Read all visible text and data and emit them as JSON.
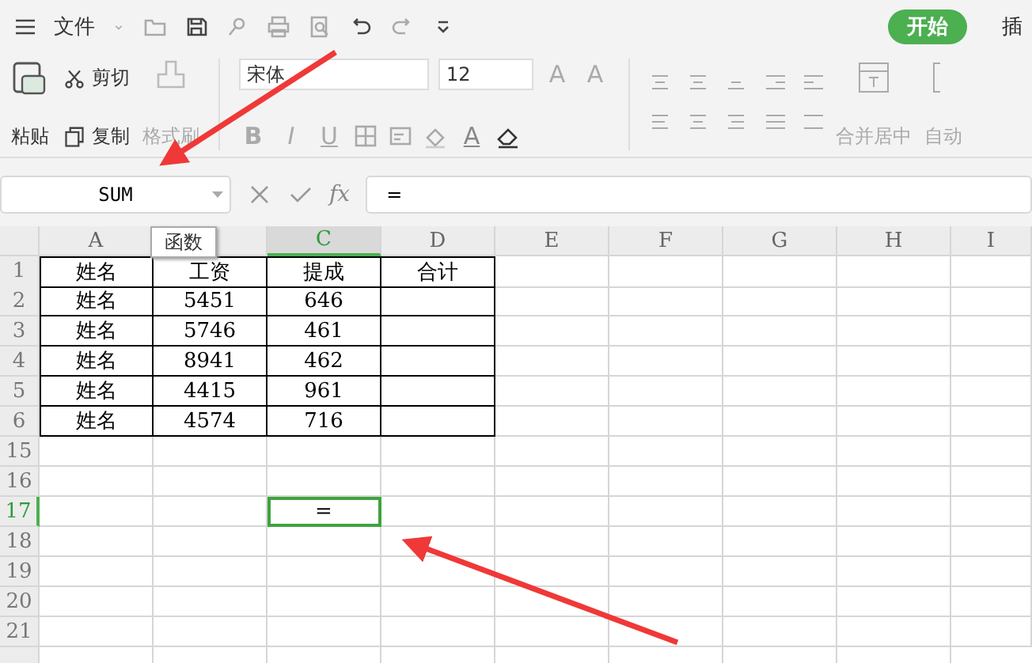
{
  "title_bar": {
    "menu": "文件",
    "start_tab": {
      "label": "开始",
      "selected": true
    },
    "next_tab": {
      "label": "插",
      "selected": false
    }
  },
  "ribbon": {
    "paste": "粘贴",
    "cut": "剪切",
    "copy": "复制",
    "format_painter": "格式刷",
    "font": "宋体",
    "size": "12",
    "format_buttons": [
      "B",
      "I",
      "U"
    ],
    "font_color": "A",
    "grow": "A",
    "shrink": "A",
    "merge": "合并居中",
    "auto": "自动"
  },
  "formula_bar": {
    "name_box": "SUM",
    "fx": "fx",
    "value": "=",
    "tooltip": "函数"
  },
  "sheet": {
    "columns": [
      {
        "label": "A",
        "selected": false
      },
      {
        "selected": false
      },
      {
        "label": "C",
        "selected": true
      },
      {
        "label": "D",
        "selected": false
      },
      {
        "label": "E",
        "selected": false
      },
      {
        "label": "F",
        "selected": false
      },
      {
        "label": "G",
        "selected": false
      },
      {
        "label": "H",
        "selected": false
      },
      {
        "label": "I",
        "selected": false
      }
    ],
    "rows": [
      {
        "number": "1",
        "selected": false,
        "table": true,
        "cells": [
          {
            "text": "姓名"
          },
          {
            "text": "工资"
          },
          {
            "text": "提成"
          },
          {
            "text": "合计"
          }
        ]
      },
      {
        "number": "2",
        "selected": false,
        "table": true,
        "cells": [
          {
            "text": "姓名"
          },
          {
            "text": "5451"
          },
          {
            "text": "646"
          },
          {}
        ]
      },
      {
        "number": "3",
        "selected": false,
        "table": true,
        "cells": [
          {
            "text": "姓名"
          },
          {
            "text": "5746"
          },
          {
            "text": "461"
          },
          {}
        ]
      },
      {
        "number": "4",
        "selected": false,
        "table": true,
        "cells": [
          {
            "text": "姓名"
          },
          {
            "text": "8941"
          },
          {
            "text": "462"
          },
          {}
        ]
      },
      {
        "number": "5",
        "selected": false,
        "table": true,
        "cells": [
          {
            "text": "姓名"
          },
          {
            "text": "4415"
          },
          {
            "text": "961"
          },
          {}
        ]
      },
      {
        "number": "6",
        "selected": false,
        "table": true,
        "cells": [
          {
            "text": "姓名"
          },
          {
            "text": "4574"
          },
          {
            "text": "716"
          },
          {}
        ]
      },
      {
        "number": "15",
        "selected": false,
        "table": false,
        "cells": []
      },
      {
        "number": "16",
        "selected": false,
        "table": false,
        "cells": []
      },
      {
        "number": "17",
        "selected": true,
        "table": false,
        "cells": [
          {
            "selected": false
          },
          {
            "selected": false
          },
          {
            "text": "=",
            "selected": true
          },
          {
            "selected": false
          }
        ]
      },
      {
        "number": "18",
        "selected": false,
        "table": false,
        "cells": []
      },
      {
        "number": "19",
        "selected": false,
        "table": false,
        "cells": []
      },
      {
        "number": "20",
        "selected": false,
        "table": false,
        "cells": []
      },
      {
        "number": "21",
        "selected": false,
        "table": false,
        "cells": []
      }
    ]
  }
}
